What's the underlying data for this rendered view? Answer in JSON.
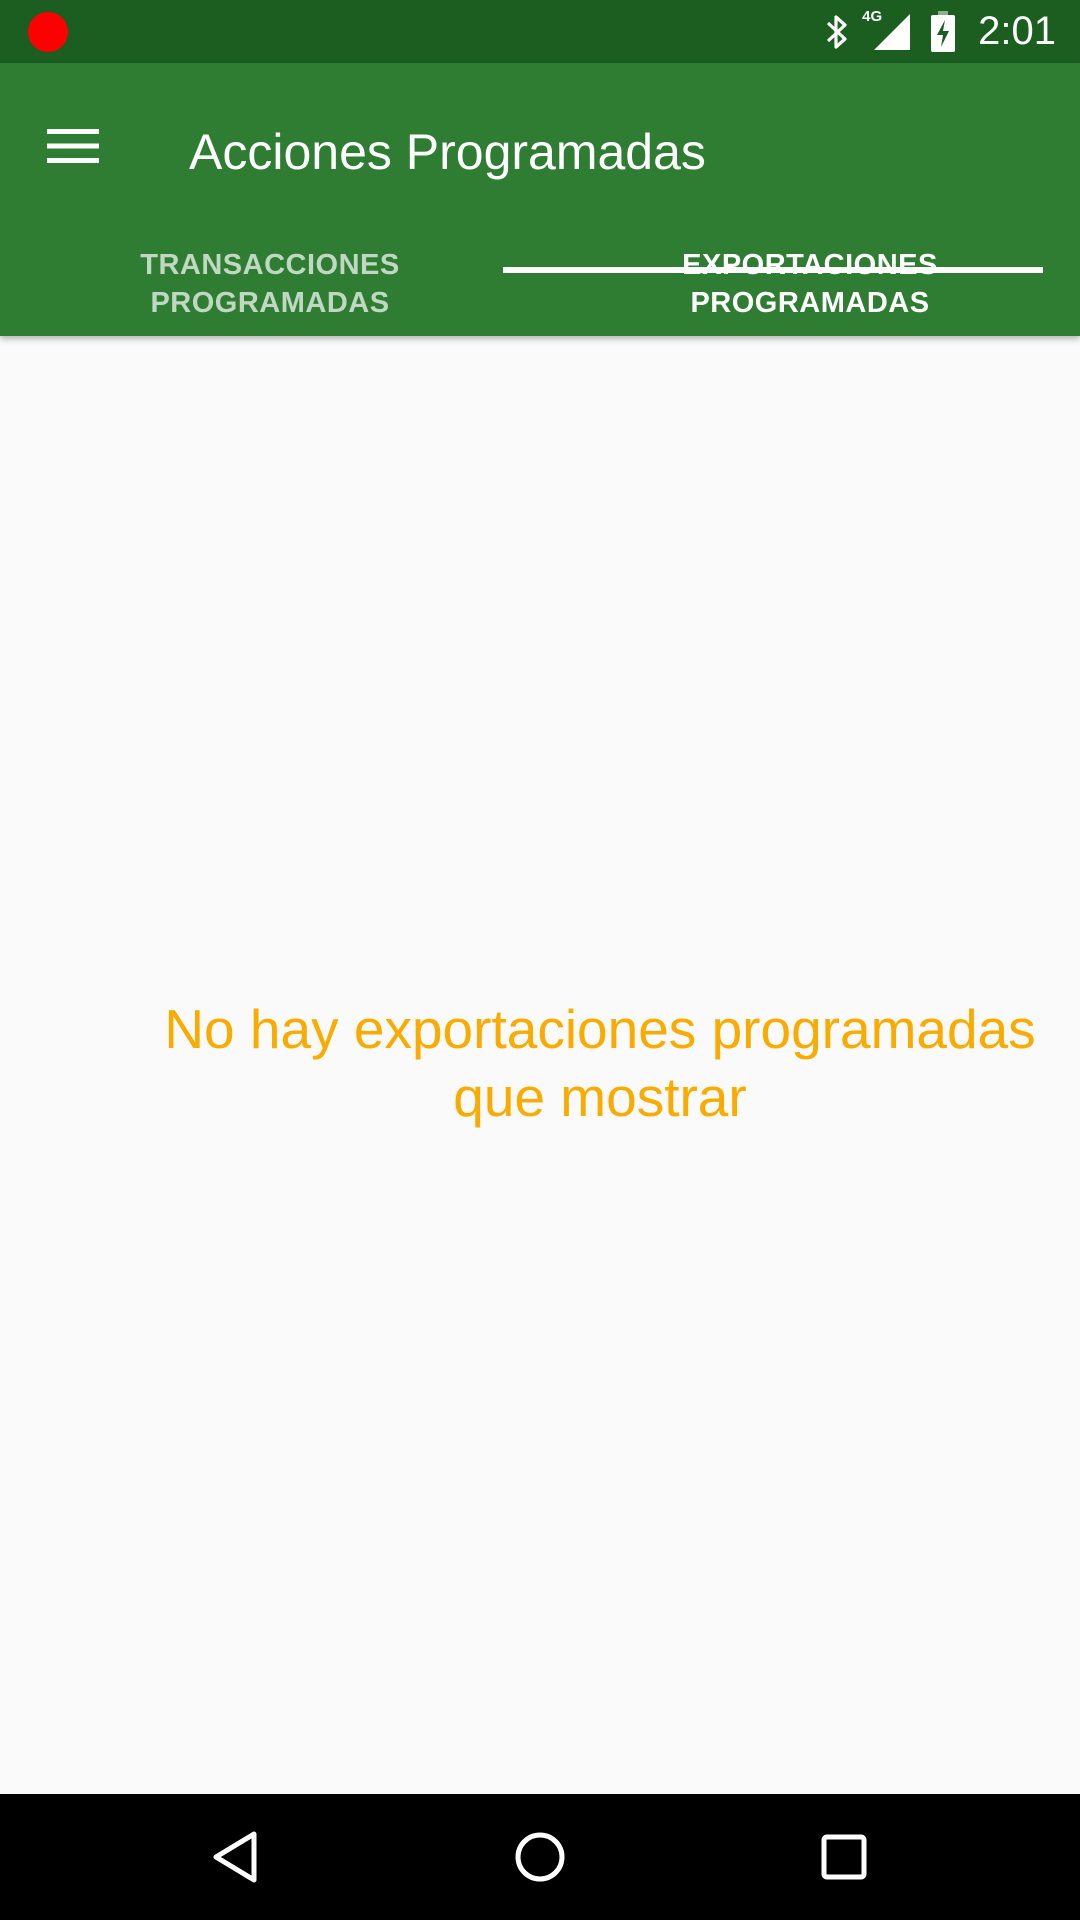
{
  "status_bar": {
    "time": "2:01",
    "network": "4G",
    "icons": [
      "recording-dot-icon",
      "bluetooth-icon",
      "signal-4g-icon",
      "battery-charging-icon"
    ],
    "recording_color": "#ff0000"
  },
  "app_bar": {
    "menu_icon": "hamburger-menu-icon",
    "title": "Acciones Programadas",
    "color": "#2e7d32"
  },
  "tabs": [
    {
      "label": "TRANSACCIONES\nPROGRAMADAS",
      "selected": false
    },
    {
      "label": "EXPORTACIONES\nPROGRAMADAS",
      "selected": true
    }
  ],
  "main": {
    "empty_message": "No hay exportaciones programadas que mostrar",
    "empty_message_color": "#f9ab00"
  },
  "nav_bar": {
    "buttons": [
      "back-icon",
      "home-icon",
      "recents-icon"
    ]
  }
}
